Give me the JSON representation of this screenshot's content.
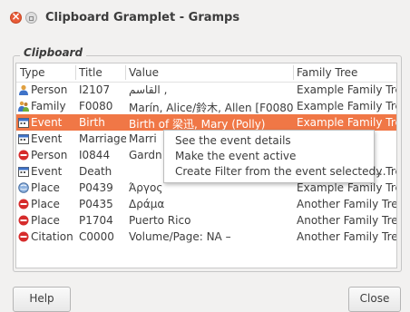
{
  "window": {
    "title": "Clipboard Gramplet - Gramps"
  },
  "frame": {
    "label": "Clipboard"
  },
  "columns": [
    "Type",
    "Title",
    "Value",
    "Family Tree"
  ],
  "rows": [
    {
      "type": "Person",
      "icon": "person-icon",
      "title": "I2107",
      "value": "القاسم ,",
      "tree": "Example Family Tree",
      "selected": false
    },
    {
      "type": "Family",
      "icon": "family-icon",
      "title": "F0080",
      "value": "Marín, Alice/鈴木, Allen [F0080]",
      "tree": "Example Family Tree",
      "selected": false
    },
    {
      "type": "Event",
      "icon": "event-icon",
      "title": "Birth",
      "value": "Birth of 梁迅, Mary (Polly)",
      "tree": "Example Family Tree",
      "selected": true
    },
    {
      "type": "Event",
      "icon": "event-icon",
      "title": "Marriage",
      "value": "Marri",
      "tree": "ee",
      "selected": false
    },
    {
      "type": "Person",
      "icon": "person-red-icon",
      "title": "I0844",
      "value": "Gardn",
      "tree": "e",
      "selected": false
    },
    {
      "type": "Event",
      "icon": "event-icon",
      "title": "Death",
      "value": "",
      "tree": "Example Family Tree",
      "selected": false
    },
    {
      "type": "Place",
      "icon": "place-icon",
      "title": "P0439",
      "value": "Άργος",
      "tree": "Example Family Tree",
      "selected": false
    },
    {
      "type": "Place",
      "icon": "place-red-icon",
      "title": "P0435",
      "value": "Δράμα",
      "tree": "Another Family Tree",
      "selected": false
    },
    {
      "type": "Place",
      "icon": "place-red-icon",
      "title": "P1704",
      "value": "Puerto Rico",
      "tree": "Another Family Tree",
      "selected": false
    },
    {
      "type": "Citation",
      "icon": "citation-red-icon",
      "title": "C0000",
      "value": "Volume/Page: NA –",
      "tree": "Another Family Tree",
      "selected": false
    }
  ],
  "context_menu": {
    "items": [
      "See the event details",
      "Make the event active",
      "Create Filter from the event selected..."
    ]
  },
  "buttons": {
    "help": "Help",
    "close": "Close"
  },
  "colors": {
    "selection": "#f07746",
    "close_button": "#e95b38",
    "red_icon": "#d62c2c"
  }
}
